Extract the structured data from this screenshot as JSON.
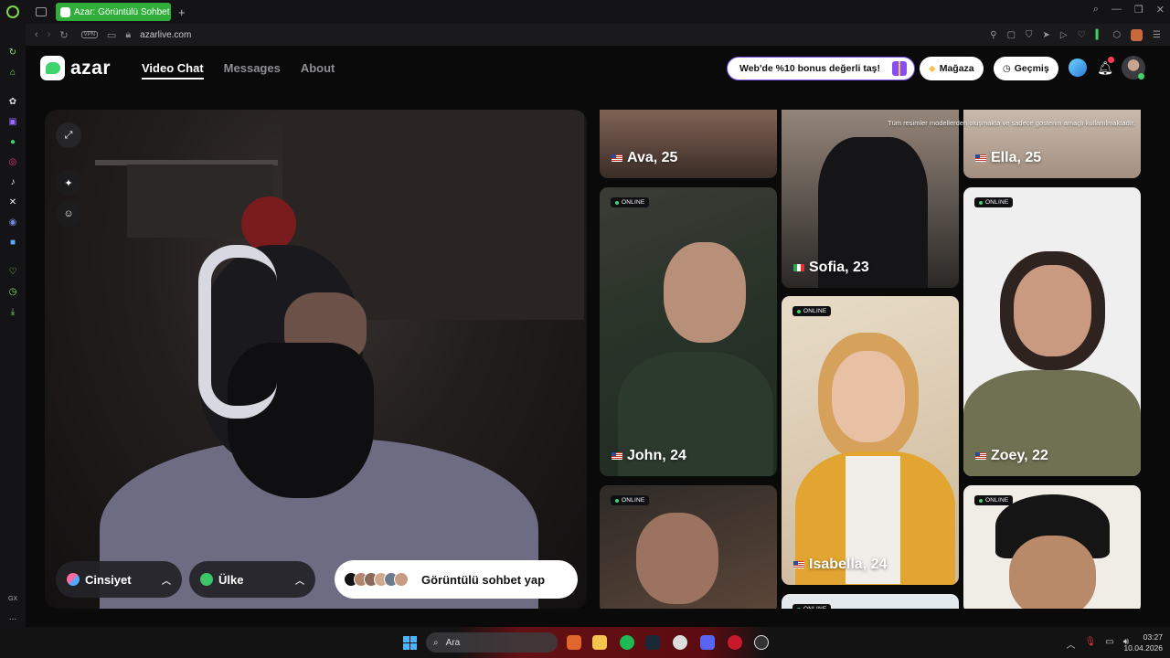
{
  "browser": {
    "tab_title": "Azar: Görüntülü Sohbet &",
    "new_tab": "+",
    "url": "azarlive.com",
    "vpn_label": "VPN"
  },
  "header": {
    "logo_text": "azar",
    "nav": [
      "Video Chat",
      "Messages",
      "About"
    ],
    "promo_text": "Web'de %10 bonus değerli taş!",
    "store_label": "Mağaza",
    "history_label": "Geçmiş",
    "notification_count": "1"
  },
  "video_panel": {
    "gender_label": "Cinsiyet",
    "country_label": "Ülke",
    "start_label": "Görüntülü sohbet yap"
  },
  "grid": {
    "disclaimer": "Tüm resimler modellerden oluşmakta ve sadece gösterim amaçlı kullanılmaktadır.",
    "online_label": "ONLINE",
    "profiles": [
      {
        "name": "Ava, 25",
        "flag": "us"
      },
      {
        "name": "Sofia, 23",
        "flag": "it"
      },
      {
        "name": "Ella, 25",
        "flag": "us"
      },
      {
        "name": "John, 24",
        "flag": "us"
      },
      {
        "name": "Isabella, 24",
        "flag": "us"
      },
      {
        "name": "Zoey, 22",
        "flag": "us"
      }
    ]
  },
  "taskbar": {
    "search_placeholder": "Ara",
    "time": "03:27",
    "date": "10.04.2026"
  },
  "sidebar_labels": {
    "gx": "GX",
    "more": "..."
  },
  "colors": {
    "accent_green": "#3fd36b",
    "promo_border": "#7b55f0",
    "tab_green": "#2fae3a"
  }
}
